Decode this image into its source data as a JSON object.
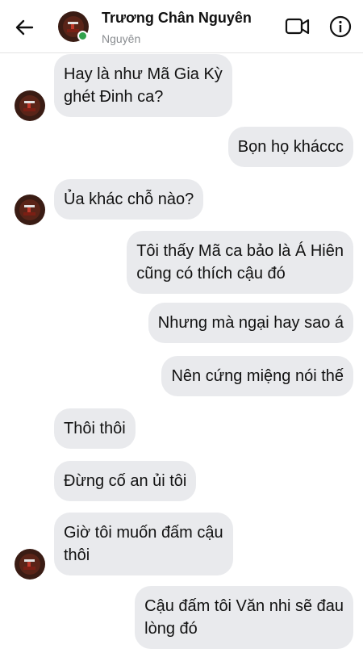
{
  "header": {
    "title": "Trương Chân Nguyên",
    "subtitle": "Nguyên"
  },
  "colors": {
    "bubble": "#e9eaed",
    "online": "#31a24c",
    "avatar_bg": "#3a1c14",
    "avatar_accent": "#c0392b"
  },
  "messages": [
    {
      "side": "in",
      "lines": [
        "Hay là như Mã Gia Kỳ",
        "ghét Đinh ca?"
      ]
    },
    {
      "side": "out",
      "lines": [
        "Bọn họ kháccc"
      ]
    },
    {
      "side": "in",
      "lines": [
        "Ủa khác chỗ nào?"
      ]
    },
    {
      "side": "out",
      "lines": [
        "Tôi thấy Mã ca bảo là Á Hiên",
        "cũng có thích cậu đó"
      ]
    },
    {
      "side": "out",
      "lines": [
        "Nhưng mà ngại hay sao á"
      ]
    },
    {
      "side": "out",
      "lines": [
        "Nên cứng miệng nói thế"
      ]
    },
    {
      "side": "in",
      "lines": [
        "Thôi thôi"
      ]
    },
    {
      "side": "in",
      "lines": [
        "Đừng cố an ủi tôi"
      ]
    },
    {
      "side": "in",
      "lines": [
        "Giờ tôi muốn đấm cậu",
        "thôi"
      ]
    },
    {
      "side": "out",
      "lines": [
        "Cậu đấm tôi Văn nhi sẽ đau",
        "lòng đó"
      ]
    }
  ]
}
